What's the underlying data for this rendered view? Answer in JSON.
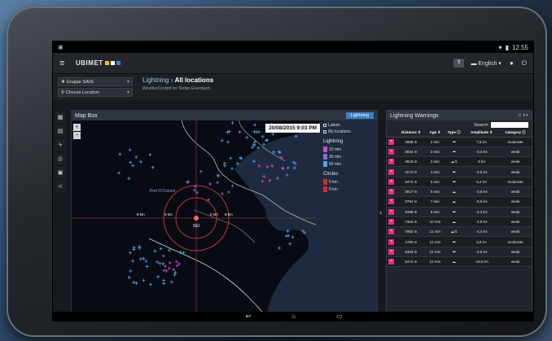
{
  "status_bar": {
    "left_icon": "image-icon",
    "time": "12:55"
  },
  "app": {
    "logo_text": "UBIMET",
    "logo_colors": [
      "#f2c500",
      "#ffffff",
      "#3b84c5"
    ],
    "help_label": "?",
    "language": "English",
    "menu_icon": "hamburger-icon"
  },
  "header": {
    "group_select": "Gruppe SAVE",
    "location_select": "Choose Location",
    "breadcrumb_prefix": "Lightning ›",
    "breadcrumb_current": "All locations",
    "subtitle": "WeatherCockpit for Stefan Eisenbach"
  },
  "sidebar": [
    "grid-icon",
    "chart-icon",
    "lightning-icon",
    "target-icon",
    "calendar-icon",
    "share-icon"
  ],
  "map_box": {
    "title": "Map Box",
    "button": "Lightning",
    "timestamp": "20/08/2015 9:03 PM",
    "zoom_in": "+",
    "zoom_out": "−",
    "legend": {
      "layers": [
        "Labels",
        "My locations"
      ],
      "lightning_header": "Lightning",
      "lightning_items": [
        {
          "label": "15 min",
          "color": "#c94fc9"
        },
        {
          "label": "30 min",
          "color": "#8b6fd6"
        },
        {
          "label": "60 min",
          "color": "#4fa9e8"
        }
      ],
      "circles_header": "Circles",
      "circle_items": [
        {
          "label": "5 km",
          "color": "#d22a2a"
        },
        {
          "label": "8 km",
          "color": "#d22a2a"
        }
      ]
    },
    "map_labels": [
      "Port O'Connor",
      "8 km",
      "5 km",
      "5 km",
      "8 km",
      "SEI"
    ]
  },
  "warnings": {
    "title": "Lightning Warnings",
    "search_label": "Search:",
    "columns": [
      "Distance",
      "Age",
      "Type",
      "Amplitude",
      "Category"
    ],
    "rows": [
      [
        "2888 m",
        "2 min",
        "cloud",
        "7,6 kA",
        "moderate"
      ],
      [
        "2834 m",
        "2 min",
        "cloud",
        "-3,4 kA",
        "weak"
      ],
      [
        "4818 m",
        "3 min",
        "ground",
        "5 kA",
        "weak"
      ],
      [
        "1173 m",
        "4 min",
        "cloud",
        "-4,6 kA",
        "weak"
      ],
      [
        "3472 m",
        "5 min",
        "cloud",
        "6,4 kA",
        "moderate"
      ],
      [
        "3517 m",
        "5 min",
        "cloud",
        "-3,6 kA",
        "weak"
      ],
      [
        "3794 m",
        "7 min",
        "cloud",
        "-5,8 kA",
        "weak"
      ],
      [
        "2498 m",
        "9 min",
        "cloud",
        "-4,3 kA",
        "weak"
      ],
      [
        "7364 m",
        "10 min",
        "cloud",
        "-4,8 kA",
        "weak"
      ],
      [
        "7962 m",
        "11 min",
        "ground",
        "-4,4 kA",
        "weak"
      ],
      [
        "4789 m",
        "12 min",
        "cloud",
        "5,8 kA",
        "moderate"
      ],
      [
        "5363 m",
        "12 min",
        "cloud",
        "-4,6 kA",
        "weak"
      ],
      [
        "5474 m",
        "12 min",
        "cloud",
        "-10,9 kA",
        "weak"
      ]
    ]
  },
  "nav": [
    "back-icon",
    "home-icon",
    "recents-icon"
  ]
}
